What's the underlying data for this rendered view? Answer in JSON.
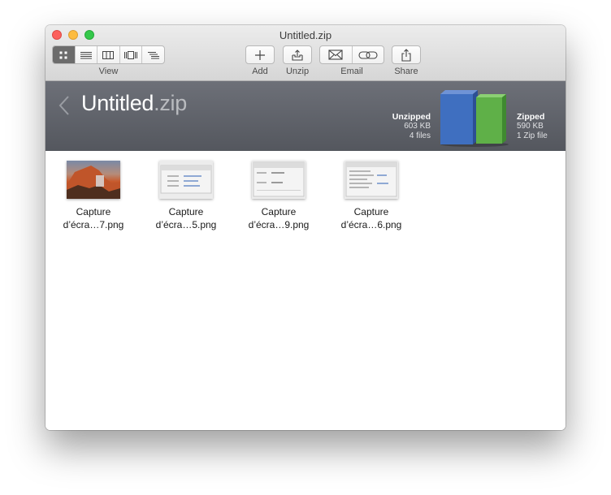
{
  "window": {
    "title": "Untitled.zip"
  },
  "toolbar": {
    "view_label": "View",
    "view_modes": [
      {
        "icon": "icon-view-icon",
        "selected": true
      },
      {
        "icon": "list-view-icon",
        "selected": false
      },
      {
        "icon": "column-view-icon",
        "selected": false
      },
      {
        "icon": "cover-flow-view-icon",
        "selected": false
      },
      {
        "icon": "outline-view-icon",
        "selected": false
      }
    ],
    "add_label": "Add",
    "unzip_label": "Unzip",
    "email_label": "Email",
    "share_label": "Share"
  },
  "banner": {
    "name": "Untitled",
    "extension": ".zip",
    "unzipped": {
      "heading": "Unzipped",
      "size": "603 KB",
      "count": "4 files"
    },
    "zipped": {
      "heading": "Zipped",
      "size": "590 KB",
      "count": "1 Zip file"
    },
    "colors": {
      "unzipped_bar": "#3f6fc0",
      "zipped_bar": "#5fb048"
    }
  },
  "files": [
    {
      "line1": "Capture",
      "line2": "d’écra…7.png",
      "thumbnail": "mountain-photo-thumbnail"
    },
    {
      "line1": "Capture",
      "line2": "d’écra…5.png",
      "thumbnail": "window-screenshot-thumbnail"
    },
    {
      "line1": "Capture",
      "line2": "d’écra…9.png",
      "thumbnail": "window-screenshot-thumbnail"
    },
    {
      "line1": "Capture",
      "line2": "d’écra…6.png",
      "thumbnail": "window-screenshot-thumbnail"
    }
  ]
}
